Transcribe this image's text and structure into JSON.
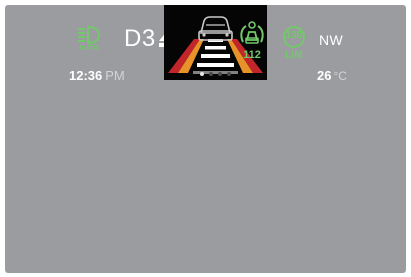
{
  "headlight": {
    "icon": "auto-headlight-icon",
    "label": "AUTO",
    "color": "#72c86a"
  },
  "gear": {
    "label": "D3",
    "shift_icon": "shift-up-arrow-icon"
  },
  "lane_assist": {
    "icon": "lane-assist-car-icon",
    "pages_total": 4,
    "page_active": 1
  },
  "traffic_sign": {
    "icon": "speed-sign-icon",
    "value": "112"
  },
  "limiter": {
    "value": "130",
    "label": "LIM"
  },
  "compass": {
    "heading": "NW"
  },
  "clock": {
    "time": "12:36",
    "ampm": "PM"
  },
  "temperature": {
    "value": "26",
    "unit": "°C"
  },
  "colors": {
    "background": "#9b9ca0",
    "indicator_green": "#72c86a",
    "text": "#ffffff"
  }
}
